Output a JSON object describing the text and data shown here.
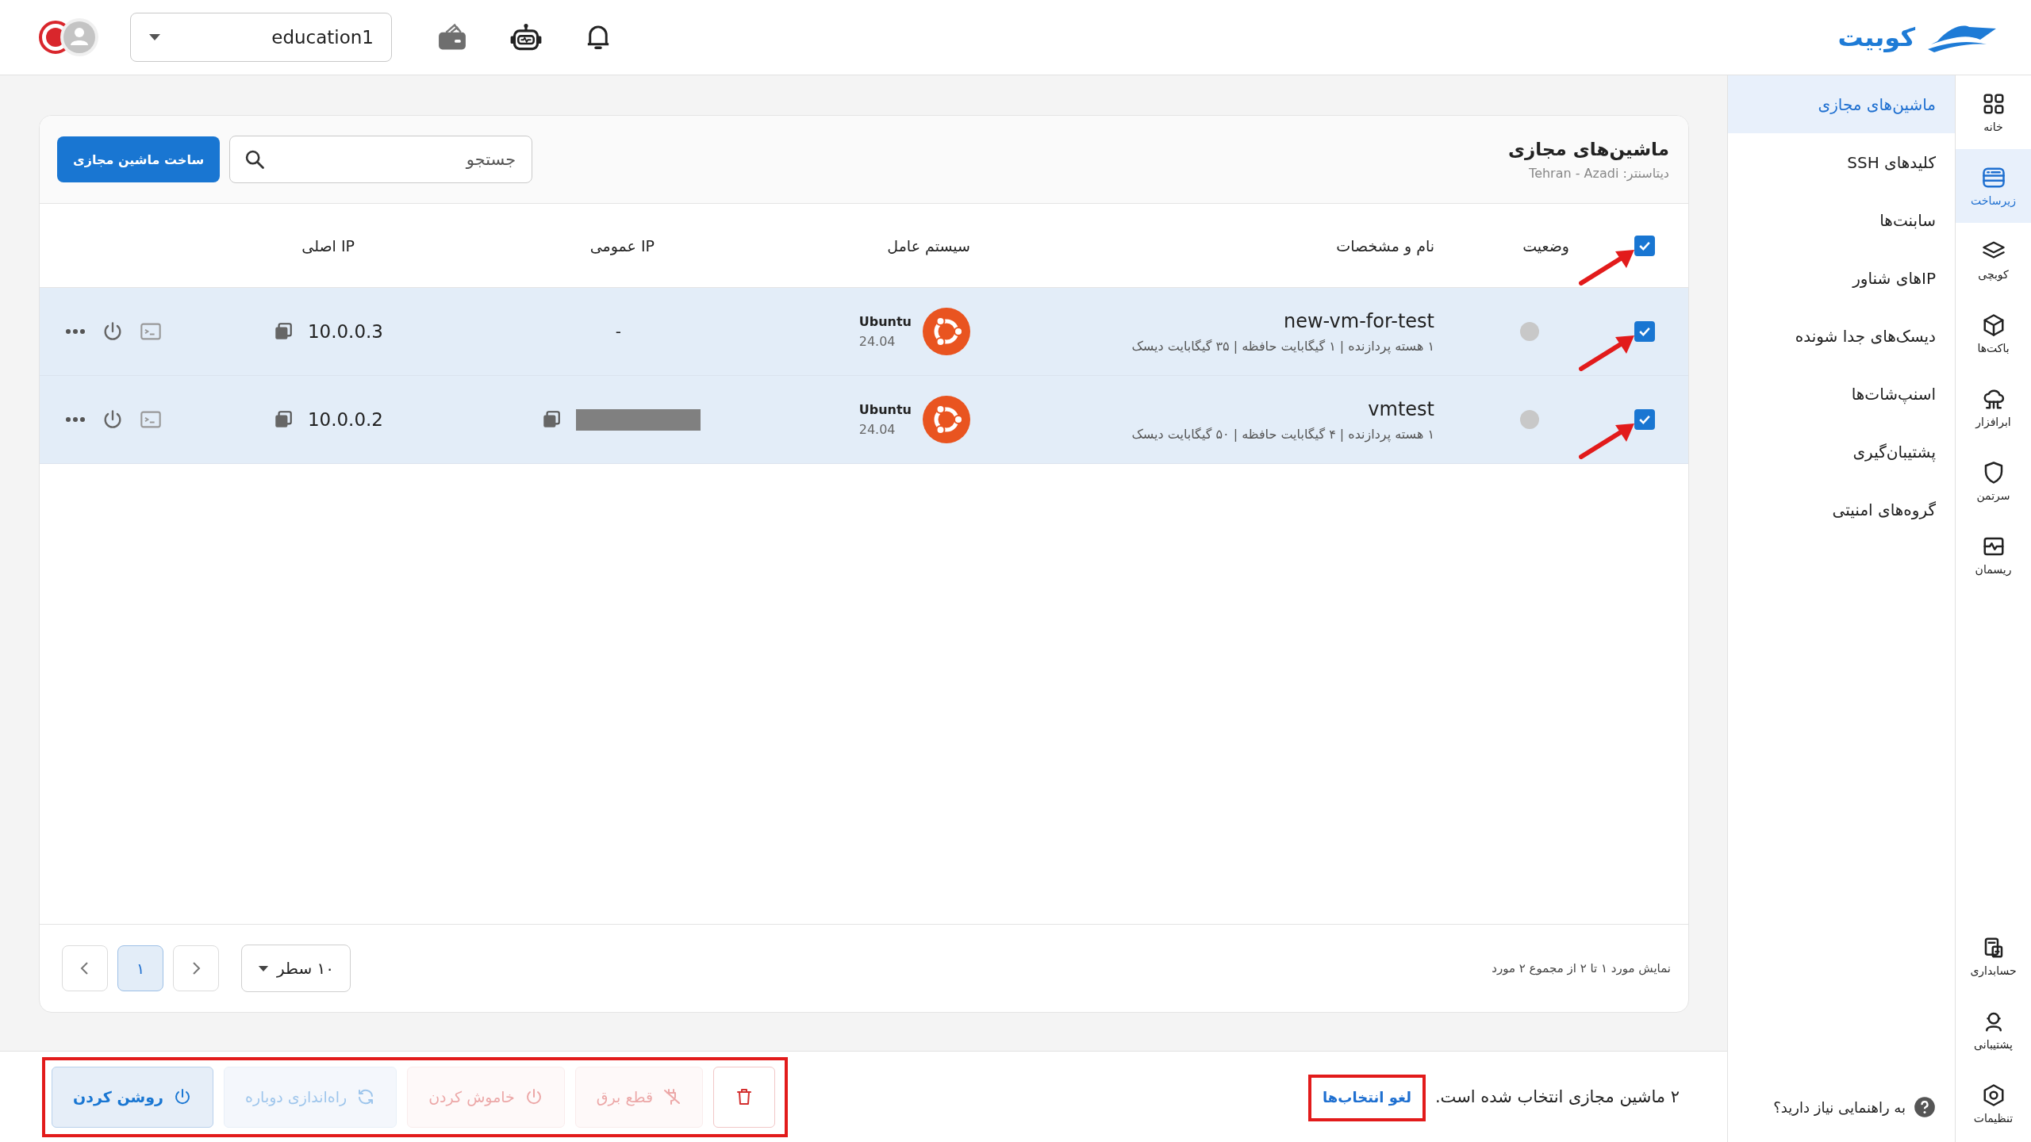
{
  "topbar": {
    "logo": "کوبیت",
    "project": "education1"
  },
  "rail": {
    "items": [
      {
        "kind": "home",
        "label": "خانه",
        "selected": false
      },
      {
        "kind": "infra",
        "label": "زیرساخت",
        "selected": true
      },
      {
        "kind": "layers",
        "label": "کوبچی",
        "selected": false
      },
      {
        "kind": "cube",
        "label": "باکت‌ها",
        "selected": false
      },
      {
        "kind": "cloud",
        "label": "ابرافزار",
        "selected": false
      },
      {
        "kind": "shield",
        "label": "سرتمن",
        "selected": false
      },
      {
        "kind": "pulse",
        "label": "ریسمان",
        "selected": false
      }
    ],
    "bottom_items": [
      {
        "kind": "accounting",
        "label": "حسابداری",
        "selected": false
      },
      {
        "kind": "support",
        "label": "پشتیبانی",
        "selected": false
      },
      {
        "kind": "settings",
        "label": "تنظیمات",
        "selected": false
      }
    ]
  },
  "subnav": {
    "items": [
      {
        "label": "ماشین‌های مجازی",
        "selected": true
      },
      {
        "label": "کلیدهای SSH",
        "selected": false
      },
      {
        "label": "سابنت‌ها",
        "selected": false
      },
      {
        "label": "IPهای شناور",
        "selected": false
      },
      {
        "label": "دیسک‌های جدا شونده",
        "selected": false
      },
      {
        "label": "اسنپ‌شات‌ها",
        "selected": false
      },
      {
        "label": "پشتیبان‌گیری",
        "selected": false
      },
      {
        "label": "گروه‌های امنیتی",
        "selected": false
      }
    ],
    "help": "به راهنمایی نیاز دارید؟"
  },
  "card": {
    "title": "ماشین‌های مجازی",
    "subtitle": "دیتاسنتر: Tehran - Azadi",
    "search": {
      "placeholder": "جستجو"
    },
    "create_button": "ساخت ماشین مجازی",
    "select_all": {
      "checked": true
    },
    "columns": [
      "وضعیت",
      "نام و مشخصات",
      "سیستم عامل",
      "IP عمومی",
      "IP اصلی"
    ],
    "rows": [
      {
        "selected": true,
        "name": "new-vm-for-test",
        "specs": "۱ هسته پردازنده | ۱ گیگابایت حافظه | ۳۵ گیگابایت دیسک",
        "os": {
          "name": "Ubuntu",
          "version": "24.04"
        },
        "public_ip": {
          "kind": "text",
          "value": "-"
        },
        "private_ip": "10.0.0.3"
      },
      {
        "selected": true,
        "name": "vmtest",
        "specs": "۱ هسته پردازنده | ۴ گیگابایت حافظه | ۵۰ گیگابایت دیسک",
        "os": {
          "name": "Ubuntu",
          "version": "24.04"
        },
        "public_ip": {
          "kind": "redacted"
        },
        "private_ip": "10.0.0.2"
      }
    ],
    "footer": {
      "summary": "نمایش مورد ۱ تا ۲ از مجموع ۲ مورد",
      "rows_per_page": "۱۰ سطر",
      "pages": [
        {
          "label": "۱",
          "selected": true
        }
      ]
    }
  },
  "actionbar": {
    "selection_text": "۲ ماشین مجازی انتخاب شده است.",
    "clear_link": "لغو انتخاب‌ها",
    "buttons": [
      {
        "kind": "delete",
        "disabled": false
      },
      {
        "kind": "power-cut",
        "label": "قطع برق",
        "disabled": true
      },
      {
        "kind": "shutdown",
        "label": "خاموش کردن",
        "disabled": true
      },
      {
        "kind": "restart",
        "label": "راه‌اندازی دوباره",
        "disabled": true
      },
      {
        "kind": "power-on",
        "label": "روشن کردن",
        "disabled": false
      }
    ]
  }
}
